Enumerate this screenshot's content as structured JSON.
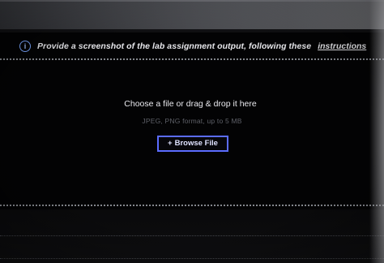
{
  "instruction": {
    "icon": "info-icon",
    "text": "Provide a screenshot of the lab assignment output, following these",
    "link_text": "instructions"
  },
  "upload": {
    "title": "Choose a file or drag & drop it here",
    "subtitle": "JPEG, PNG format, up to 5 MB",
    "browse_plus": "+",
    "browse_label": "Browse File"
  },
  "colors": {
    "accent": "#5b6cff",
    "info": "#7aa7ff",
    "background": "#030304",
    "text": "#e6e6ea",
    "muted": "#5e6068"
  }
}
